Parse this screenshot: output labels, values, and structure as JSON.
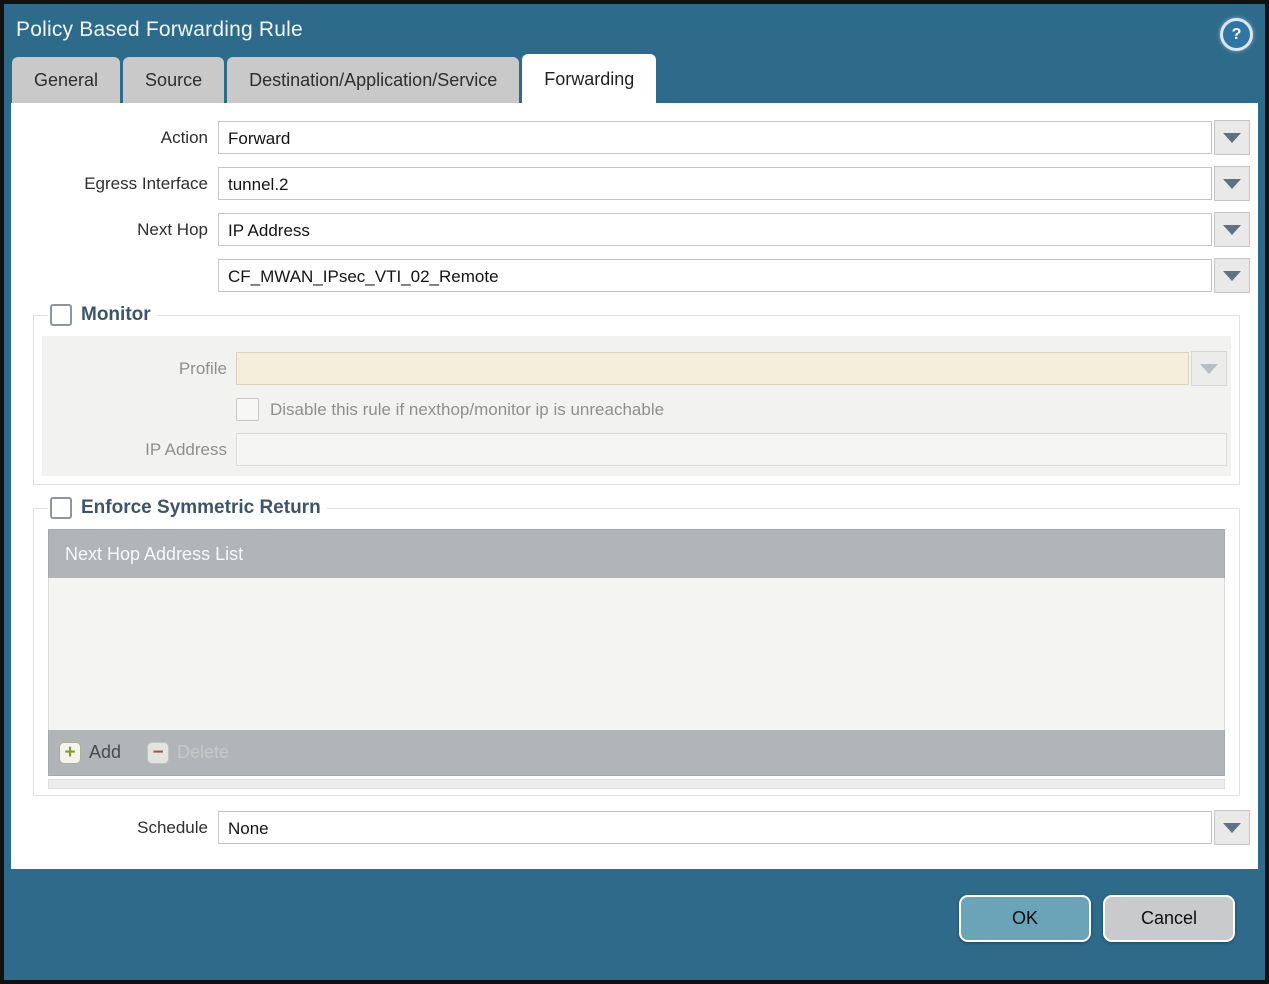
{
  "window": {
    "title": "Policy Based Forwarding Rule"
  },
  "icons": {
    "help": "?",
    "add": "+",
    "delete": "−"
  },
  "tabs": [
    {
      "label": "General",
      "active": false
    },
    {
      "label": "Source",
      "active": false
    },
    {
      "label": "Destination/Application/Service",
      "active": false
    },
    {
      "label": "Forwarding",
      "active": true
    }
  ],
  "form": {
    "action": {
      "label": "Action",
      "value": "Forward"
    },
    "egress_interface": {
      "label": "Egress Interface",
      "value": "tunnel.2"
    },
    "next_hop": {
      "label": "Next Hop",
      "value": "IP Address"
    },
    "next_hop_address": {
      "value": "CF_MWAN_IPsec_VTI_02_Remote"
    },
    "schedule": {
      "label": "Schedule",
      "value": "None"
    }
  },
  "monitor": {
    "title": "Monitor",
    "checked": false,
    "profile": {
      "label": "Profile",
      "value": ""
    },
    "disable_rule": {
      "label": "Disable this rule if nexthop/monitor ip is unreachable",
      "checked": false
    },
    "ip_address": {
      "label": "IP Address",
      "value": ""
    }
  },
  "enforce_symmetric_return": {
    "title": "Enforce Symmetric Return",
    "checked": false,
    "table": {
      "header": "Next Hop Address List",
      "rows": []
    },
    "add_label": "Add",
    "delete_label": "Delete"
  },
  "footer": {
    "ok_label": "OK",
    "cancel_label": "Cancel"
  },
  "colors": {
    "titlebar_teal": "#2e6b8a",
    "ok_button": "#6ba4b8",
    "cancel_button": "#c9cacc",
    "profile_field_beige": "#f5eedb",
    "table_bar_grey": "#b1b5b8",
    "legend_text": "#3e5468"
  }
}
